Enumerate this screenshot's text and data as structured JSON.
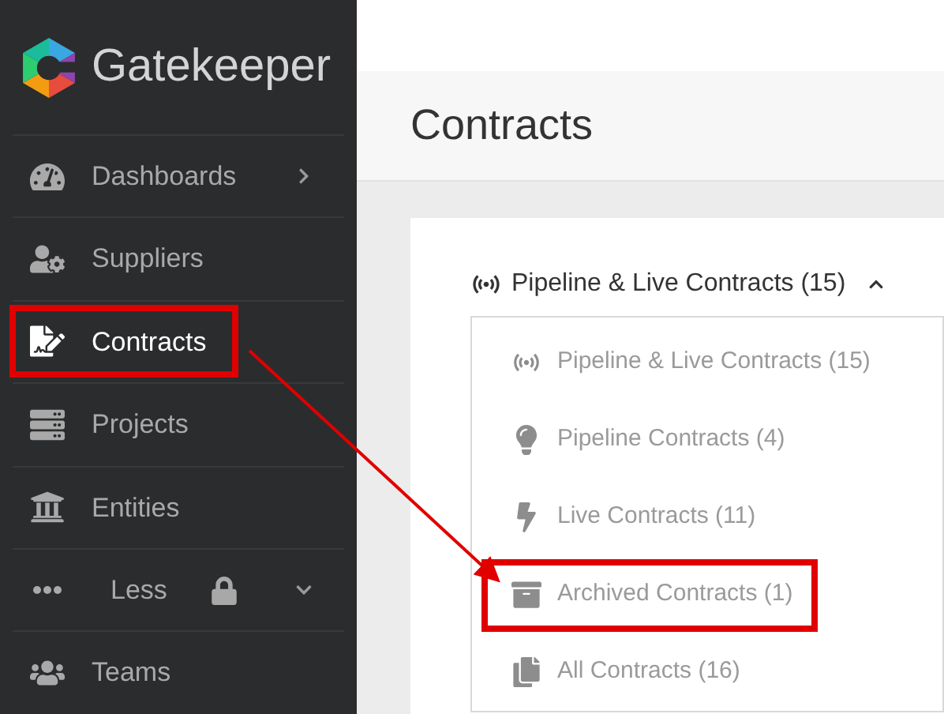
{
  "brand": {
    "name": "Gatekeeper"
  },
  "sidebar": {
    "items": [
      {
        "label": "Dashboards",
        "selected": false,
        "highlighted": false,
        "kind": "submenu"
      },
      {
        "label": "Suppliers",
        "selected": false,
        "highlighted": false,
        "kind": "link"
      },
      {
        "label": "Contracts",
        "selected": true,
        "highlighted": true,
        "kind": "link"
      },
      {
        "label": "Projects",
        "selected": false,
        "highlighted": false,
        "kind": "link"
      },
      {
        "label": "Entities",
        "selected": false,
        "highlighted": false,
        "kind": "link"
      },
      {
        "label": "Less",
        "selected": false,
        "highlighted": false,
        "kind": "locked-group"
      },
      {
        "label": "Teams",
        "selected": false,
        "highlighted": false,
        "kind": "link"
      }
    ]
  },
  "page": {
    "title": "Contracts"
  },
  "filter": {
    "label": "Pipeline & Live Contracts (15)",
    "expanded": true,
    "options": [
      {
        "label": "Pipeline & Live Contracts (15)",
        "highlighted": false
      },
      {
        "label": "Pipeline Contracts (4)",
        "highlighted": false
      },
      {
        "label": "Live Contracts (11)",
        "highlighted": false
      },
      {
        "label": "Archived Contracts (1)",
        "highlighted": true
      },
      {
        "label": "All Contracts (16)",
        "highlighted": false
      }
    ]
  },
  "annotation": {
    "arrow": true
  }
}
